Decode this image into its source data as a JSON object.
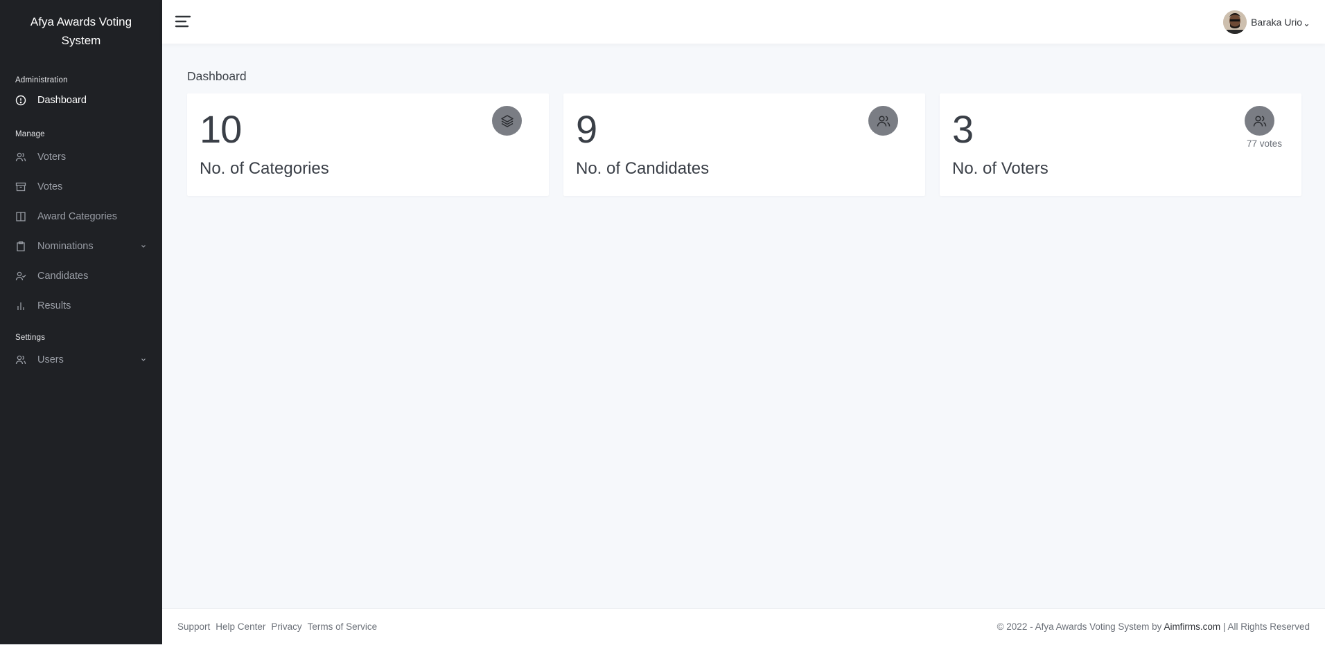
{
  "sidebar": {
    "brand": "Afya Awards Voting System",
    "sections": [
      {
        "heading": "Administration",
        "items": [
          {
            "label": "Dashboard"
          }
        ]
      },
      {
        "heading": "Manage",
        "items": [
          {
            "label": "Voters"
          },
          {
            "label": "Votes"
          },
          {
            "label": "Award Categories"
          },
          {
            "label": "Nominations"
          },
          {
            "label": "Candidates"
          },
          {
            "label": "Results"
          }
        ]
      },
      {
        "heading": "Settings",
        "items": [
          {
            "label": "Users"
          }
        ]
      }
    ]
  },
  "header": {
    "user_name": "Baraka Urio"
  },
  "main": {
    "title": "Dashboard",
    "cards": [
      {
        "value": "10",
        "label": "No. of Categories",
        "icon": "layers-icon"
      },
      {
        "value": "9",
        "label": "No. of Candidates",
        "icon": "users-icon"
      },
      {
        "value": "3",
        "label": "No. of Voters",
        "icon": "users-icon",
        "sub": "77 votes"
      }
    ]
  },
  "footer": {
    "links": [
      "Support",
      "Help Center",
      "Privacy",
      "Terms of Service"
    ],
    "copy_prefix": "© 2022 - Afya Awards Voting System by ",
    "copy_brand": "Aimfirms.com",
    "copy_suffix": " | All Rights Reserved"
  },
  "colors": {
    "sidebar_bg": "#1f2125",
    "page_bg": "#f6f8fb",
    "badge_bg": "#7a7d84"
  }
}
